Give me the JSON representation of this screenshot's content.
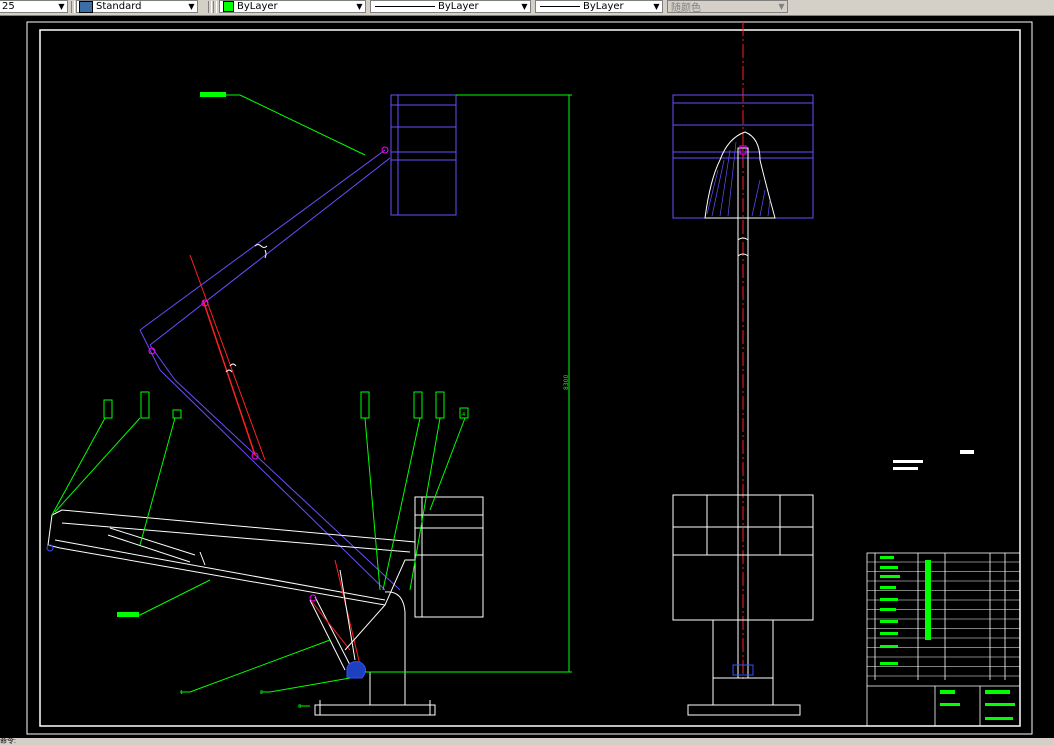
{
  "toolbar": {
    "linetype_scale": "25",
    "text_style": "Standard",
    "color_label": "ByLayer",
    "linetype_label": "ByLayer",
    "lineweight_label": "ByLayer",
    "plot_style": "随颜色",
    "color_accent": "#00ff00"
  },
  "drawing": {
    "dimension_height": "8300",
    "callouts": [
      "1",
      "2",
      "3",
      "4"
    ],
    "title_block_color": "#00ff00",
    "frame_color": "#ffffff"
  },
  "statusbar": {
    "command_prompt": "命令:"
  }
}
